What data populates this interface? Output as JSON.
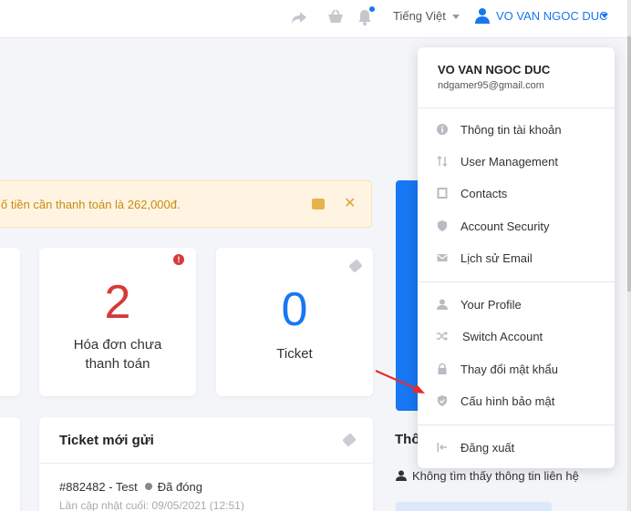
{
  "topbar": {
    "language": "Tiếng Việt",
    "user_name": "VO VAN NGOC DUC"
  },
  "alert": {
    "text": "ố tiền cần thanh toán là 262,000đ.",
    "close": "✕"
  },
  "stats": {
    "invoices": {
      "value": "2",
      "label_line1": "Hóa đơn chưa",
      "label_line2": "thanh toán"
    },
    "tickets": {
      "value": "0",
      "label": "Ticket"
    }
  },
  "ticket_list": {
    "title": "Ticket mới gửi",
    "row_id": "#882482 - Test",
    "row_status": "Đã đóng",
    "row_updated": "Lần cập nhật cuối: 09/05/2021 (12:51)"
  },
  "contact": {
    "title": "Thô",
    "empty_text": "Không tìm thấy thông tin liên hệ"
  },
  "dropdown": {
    "name": "VO VAN NGOC DUC",
    "email": "ndgamer95@gmail.com",
    "items": [
      {
        "label": "Thông tin tài khoản",
        "icon": "info-icon"
      },
      {
        "label": "User Management",
        "icon": "sort-icon"
      },
      {
        "label": "Contacts",
        "icon": "contacts-icon"
      },
      {
        "label": "Account Security",
        "icon": "shield-icon"
      },
      {
        "label": "Lịch sử Email",
        "icon": "mail-icon"
      },
      {
        "label": "Your Profile",
        "icon": "user-icon"
      },
      {
        "label": "Switch Account",
        "icon": "shuffle-icon"
      },
      {
        "label": "Thay đổi mật khẩu",
        "icon": "lock-icon"
      },
      {
        "label": "Cấu hình bảo mật",
        "icon": "shield-check-icon"
      },
      {
        "label": "Đăng xuất",
        "icon": "logout-icon"
      }
    ]
  },
  "colors": {
    "accent": "#1877f2",
    "danger": "#d63a3a",
    "warning_text": "#c98b0e"
  }
}
